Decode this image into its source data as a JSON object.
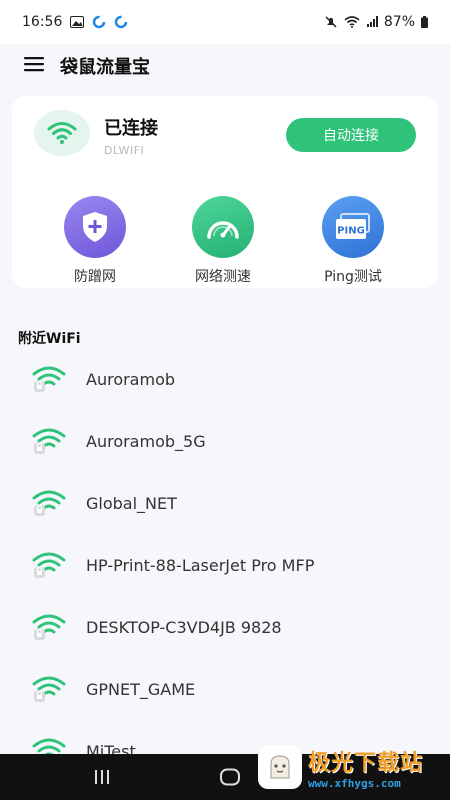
{
  "status_bar": {
    "time": "16:56",
    "battery": "87%"
  },
  "app_bar": {
    "title": "袋鼠流量宝"
  },
  "connection": {
    "status": "已连接",
    "ssid": "DLWIFI",
    "auto_connect_label": "自动连接"
  },
  "features": [
    {
      "label": "防蹭网",
      "icon": "shield-plus-icon"
    },
    {
      "label": "网络测速",
      "icon": "speedometer-icon"
    },
    {
      "label": "Ping测试",
      "icon": "ping-icon"
    }
  ],
  "nearby": {
    "title": "附近WiFi",
    "networks": [
      {
        "name": "Auroramob"
      },
      {
        "name": "Auroramob_5G"
      },
      {
        "name": "Global_NET"
      },
      {
        "name": "HP-Print-88-LaserJet Pro MFP"
      },
      {
        "name": "DESKTOP-C3VD4JB 9828"
      },
      {
        "name": "GPNET_GAME"
      },
      {
        "name": "MiTest"
      }
    ]
  },
  "watermark": {
    "main": "极光下载站",
    "sub": "www.xfhygs.com"
  },
  "colors": {
    "accent_green": "#2fc37a",
    "wifi_green": "#2fc37a",
    "purple": "#6f57d8",
    "blue": "#2f72d6"
  },
  "icon_ping_text": "PING"
}
